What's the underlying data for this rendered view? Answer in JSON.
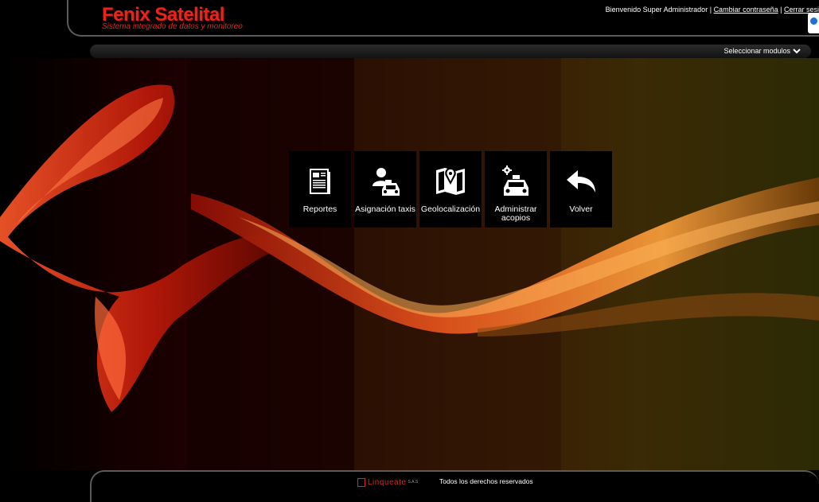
{
  "header": {
    "logo_title": "Fenix Satelital",
    "logo_subtitle": "Sistema integrado de datos y monitoreo",
    "welcome": "Bienvenido Super Administrador",
    "separator": "|",
    "change_password": "Cambiar contraseña",
    "logout": "Cerrar sesi"
  },
  "modules_bar": {
    "select_label": "Seleccionar modulos"
  },
  "tiles": [
    {
      "label": "Reportes",
      "icon": "report-icon"
    },
    {
      "label": "Asignación taxis",
      "icon": "driver-taxi-icon"
    },
    {
      "label": "Geolocalización",
      "icon": "map-pin-icon"
    },
    {
      "label": "Administrar acopios",
      "icon": "taxi-settings-icon"
    },
    {
      "label": "Volver",
      "icon": "back-arrow-icon"
    }
  ],
  "footer": {
    "brand": "Linqueate",
    "brand_suffix": "S.A.S",
    "rights": "Todos los derechos reservados"
  },
  "colors": {
    "brand_red": "#e8251a",
    "tile_bg": "#000000",
    "bar_bg": "#1e1e1e"
  }
}
